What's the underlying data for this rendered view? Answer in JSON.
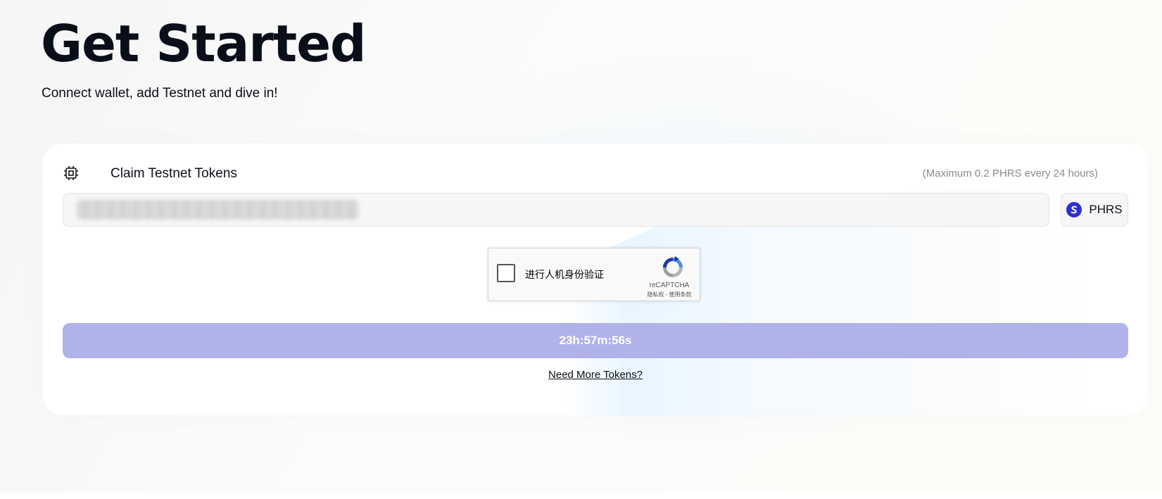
{
  "header": {
    "title": "Get Started",
    "subtitle": "Connect wallet, add Testnet and dive in!"
  },
  "faucet": {
    "title": "Claim Testnet Tokens",
    "icon": "chip-icon",
    "limit_note": "(Maximum 0.2 PHRS every 24 hours)",
    "address_input": {
      "value": "",
      "placeholder": ""
    },
    "token": {
      "label": "PHRS",
      "icon": "pharos-logo-icon",
      "color": "#2e2fd1"
    },
    "captcha": {
      "label": "进行人机身份验证",
      "brand": "reCAPTCHA",
      "terms": "隐私权 - 使用条款"
    },
    "claim_button": {
      "label": "23h:57m:56s",
      "color": "#b0b3ea"
    },
    "more_tokens_link": "Need More Tokens?"
  }
}
